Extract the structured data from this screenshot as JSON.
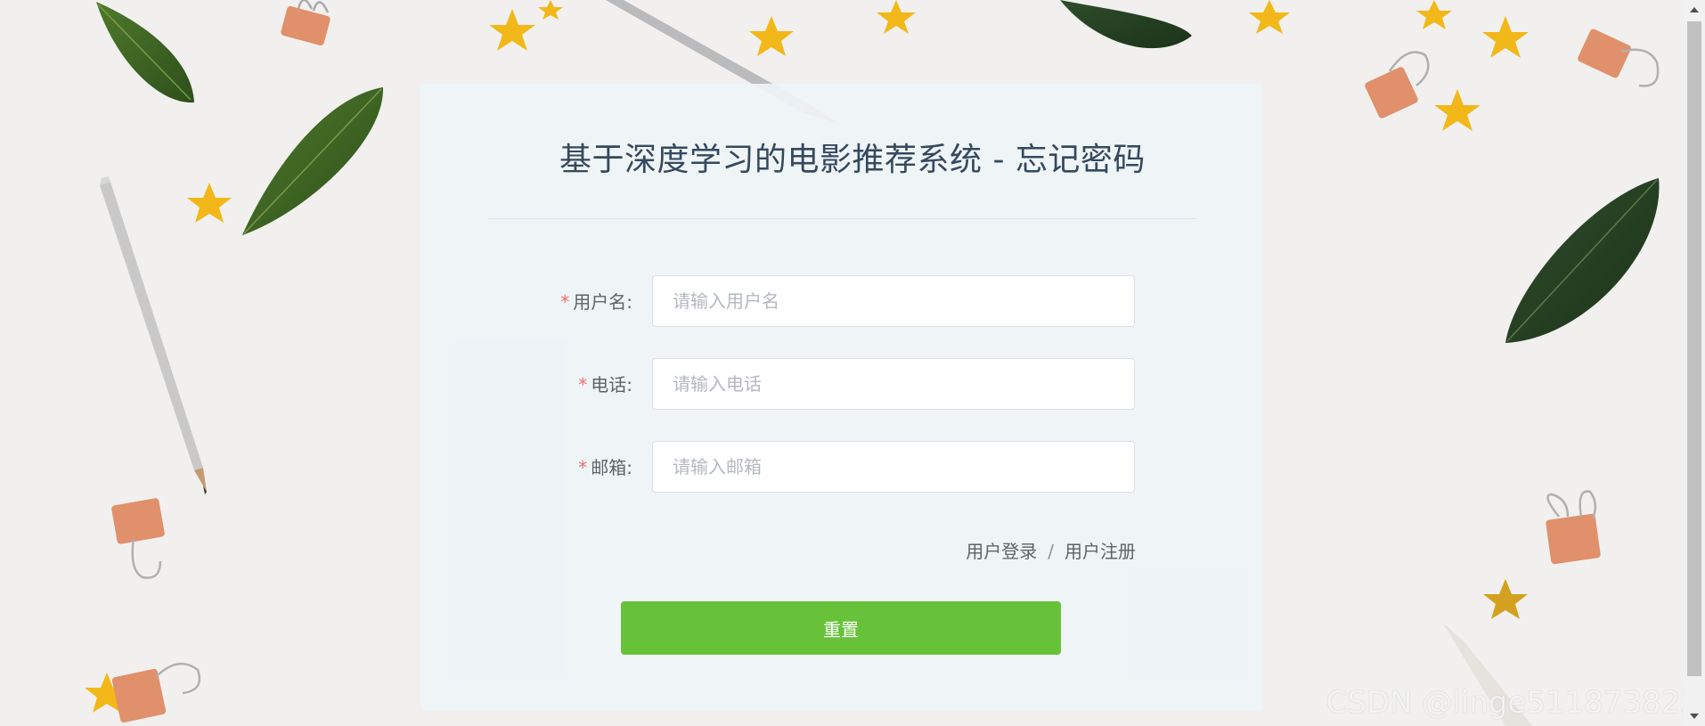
{
  "title": "基于深度学习的电影推荐系统 - 忘记密码",
  "form": {
    "required_mark": "*",
    "username": {
      "label": "用户名:",
      "placeholder": "请输入用户名",
      "value": ""
    },
    "phone": {
      "label": "电话:",
      "placeholder": "请输入电话",
      "value": ""
    },
    "email": {
      "label": "邮箱:",
      "placeholder": "请输入邮箱",
      "value": ""
    }
  },
  "links": {
    "login": "用户登录",
    "separator": "/",
    "register": "用户注册"
  },
  "reset_button": "重置",
  "watermark": "CSDN @linge511873822",
  "colors": {
    "primary_button": "#67c23a",
    "required": "#f56c6c",
    "title": "#34495e",
    "card_background": "#eef3f8"
  }
}
